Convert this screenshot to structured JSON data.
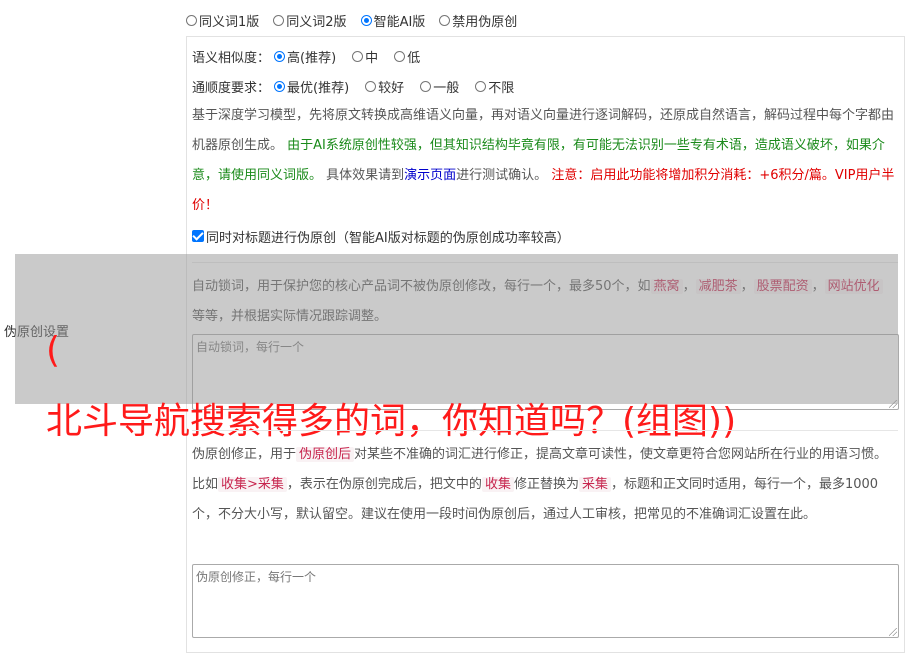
{
  "version_options": [
    {
      "label": "同义词1版",
      "selected": false
    },
    {
      "label": "同义词2版",
      "selected": false
    },
    {
      "label": "智能AI版",
      "selected": true
    },
    {
      "label": "禁用伪原创",
      "selected": false
    }
  ],
  "similarity": {
    "label": "语义相似度：",
    "options": [
      {
        "label": "高(推荐)",
        "selected": true
      },
      {
        "label": "中",
        "selected": false
      },
      {
        "label": "低",
        "selected": false
      }
    ]
  },
  "fluency": {
    "label": "通顺度要求：",
    "options": [
      {
        "label": "最优(推荐)",
        "selected": true
      },
      {
        "label": "较好",
        "selected": false
      },
      {
        "label": "一般",
        "selected": false
      },
      {
        "label": "不限",
        "selected": false
      }
    ]
  },
  "description": {
    "part1": "基于深度学习模型，先将原文转换成高维语义向量，再对语义向量进行逐词解码，还原成自然语言，解码过程中每个字都由机器原创生成。 ",
    "warning_green": "由于AI系统原创性较强，但其知识结构毕竟有限，有可能无法识别一些专有术语，造成语义破坏，如果介意，请使用同义词版。",
    "part2": " 具体效果请到",
    "demo_link": "演示页面",
    "part3": "进行测试确认。 ",
    "warning_red": "注意：启用此功能将增加积分消耗：+6积分/篇。VIP用户半价！"
  },
  "title_checkbox": {
    "label": "同时对标题进行伪原创（智能AI版对标题的伪原创成功率较高）",
    "checked": true
  },
  "lock_words": {
    "text1": "自动锁词，用于保护您的核心产品词不被伪原创修改，每行一个，最多50个，如",
    "tags": [
      "燕窝",
      "减肥茶",
      "股票配资",
      "网站优化"
    ],
    "text2": "等等，并根据实际情况跟踪调整。",
    "placeholder": "自动锁词，每行一个"
  },
  "side_label": "伪原创设置",
  "overlay_title": {
    "line1": "(",
    "line2": "北斗导航搜索得多的词，你知道吗？(组图))"
  },
  "correction": {
    "text1": "伪原创修正，用于",
    "tag1": "伪原创后",
    "text2": "对某些不准确的词汇进行修正，提高文章可读性，使文章更符合您网站所在行业的用语习惯。比如",
    "tag2": "收集>采集",
    "text3": "，表示在伪原创完成后，把文中的",
    "tag3": "收集",
    "text4": "修正替换为",
    "tag4": "采集",
    "text5": "，标题和正文同时适用，每行一个，最多1000个，不分大小写，默认留空。建议在使用一段时间伪原创后，通过人工审核，把常见的不准确词汇设置在此。",
    "placeholder": "伪原创修正，每行一个"
  }
}
